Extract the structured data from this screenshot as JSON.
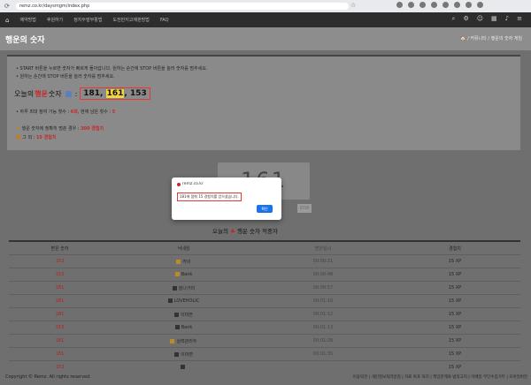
{
  "browser": {
    "url": "remz.co.kr/daysmgm/index.php"
  },
  "nav": {
    "menus": [
      "예약방법",
      "후원하기",
      "정지두발부활법",
      "도전만지고재판방법",
      "FAQ"
    ]
  },
  "header": {
    "title": "행운의 숫자",
    "breadcrumb": "🏠 / 커뮤니티 / 행운의 숫자 게임"
  },
  "panel": {
    "note1": "• START 버튼을 누르면 숫자가 빠르게 돌아갑니다. 원하는 순간에 STOP 버튼을 눌러 숫자를 멈추세요.",
    "note2": "• 원하는 순간에 STOP 버튼을 눌러 숫자를 멈추세요.",
    "lucky_prefix": "오늘의",
    "lucky_word": "행운",
    "lucky_suffix": "숫자",
    "num1": "181,",
    "num2": "161",
    "num3": ", 153",
    "limit_prefix": "• 하루 최대 참여 가능 횟수 :",
    "limit_value": "6회",
    "limit_mid": ", 현재 남은 횟수 :",
    "limit_remaining": "5",
    "reward1_label": "행운 숫자에 정확히 멈춘 경우 :",
    "reward1_value": "300 경험치",
    "reward2_label": "그 외 :",
    "reward2_value": "15 경험치"
  },
  "game": {
    "display_number": "161",
    "stop_label": "STOP"
  },
  "table": {
    "title_prefix": "오늘의",
    "title_word": "행운",
    "title_suffix": "숫자 적중자",
    "headers": [
      "받은 숫자",
      "닉네임",
      "받은일시",
      "경험치"
    ],
    "rows": [
      {
        "number": "153",
        "nick": "카이",
        "time": "00:00:21",
        "xp": "15 XP",
        "badge": "gold"
      },
      {
        "number": "153",
        "nick": "Bank",
        "time": "00:00:48",
        "xp": "15 XP",
        "badge": "gold"
      },
      {
        "number": "181",
        "nick": "잘나가리",
        "time": "00:00:57",
        "xp": "15 XP",
        "badge": "dark"
      },
      {
        "number": "181",
        "nick": "LOVEHOLIC",
        "time": "00:01:10",
        "xp": "15 XP",
        "badge": "dark"
      },
      {
        "number": "181",
        "nick": "이미면",
        "time": "00:01:12",
        "xp": "15 XP",
        "badge": "dark"
      },
      {
        "number": "153",
        "nick": "Bank",
        "time": "00:01:13",
        "xp": "15 XP",
        "badge": "dark"
      },
      {
        "number": "181",
        "nick": "실력관리두",
        "time": "00:01:28",
        "xp": "15 XP",
        "badge": "gold"
      },
      {
        "number": "181",
        "nick": "이미면",
        "time": "00:01:35",
        "xp": "15 XP",
        "badge": "dark"
      },
      {
        "number": "153",
        "nick": "",
        "time": "",
        "xp": "15 XP",
        "badge": "dark"
      }
    ]
  },
  "footer": {
    "copyright": "Copyright © Remz. All rights reserved.",
    "links": "이용약관 | 개인정보처리방침 | 자료 복포 처치 | 책임한계와 법적고지 | 이메일 무단수집거부 | 모바일버전"
  },
  "modal": {
    "site": "remz.co.kr",
    "message": "181에 멈춰 15 경험치를 얻으셨습니다.",
    "ok_label": "확인"
  }
}
